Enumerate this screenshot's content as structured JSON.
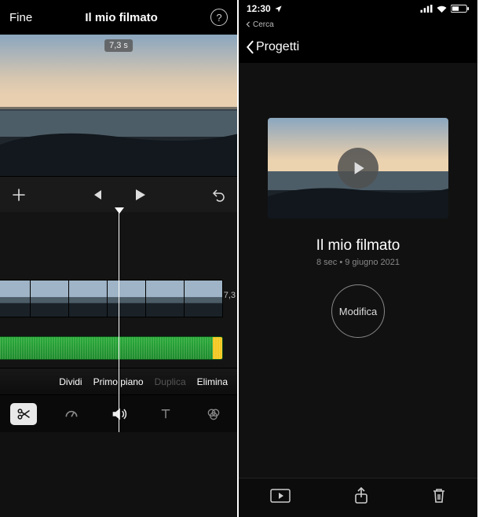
{
  "editor": {
    "done_label": "Fine",
    "title": "Il mio filmato",
    "duration_badge": "7,3 s",
    "clip_end_label": "7,3",
    "actions": {
      "split": "Dividi",
      "foreground": "Primo piano",
      "duplicate": "Duplica",
      "delete": "Elimina"
    },
    "tools": {
      "cut": "scissors-icon",
      "speed": "speedometer-icon",
      "audio": "volume-icon",
      "text": "text-icon",
      "filters": "filters-icon"
    },
    "colors": {
      "audio_track": "#2aaa3c",
      "audio_tail": "#f4c722"
    }
  },
  "status": {
    "time": "12:30",
    "back_app": "Cerca"
  },
  "project": {
    "back_label": "Progetti",
    "title": "Il mio filmato",
    "meta": "8 sec • 9 giugno 2021",
    "edit_label": "Modifica"
  }
}
